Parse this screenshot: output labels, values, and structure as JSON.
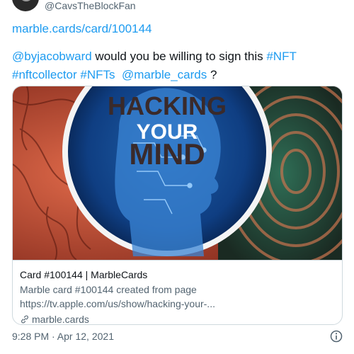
{
  "tweet": {
    "handle": "@CavsTheBlockFan",
    "link": "marble.cards/card/100144",
    "text": {
      "mention1": "@byjacobward",
      "plain1": " would you be willing to sign this ",
      "tag1": "#NFT",
      "tag2": "#nftcollector",
      "tag3": "#NFTs",
      "mention2": "@marble_cards",
      "plain2": " ?"
    },
    "timestamp": "9:28 PM · Apr 12, 2021"
  },
  "card": {
    "image_text": [
      "HACKING",
      "YOUR",
      "MIND"
    ],
    "title": "Card #100144 | MarbleCards",
    "description_line1": "Marble card #100144 created from page",
    "description_line2": "https://tv.apple.com/us/show/hacking-your-...",
    "domain": "marble.cards"
  },
  "icons": {
    "link": "link-icon",
    "info": "info-icon"
  },
  "colors": {
    "link_blue": "#1d9bf0",
    "secondary_text": "#536471",
    "border": "#cfd9de"
  }
}
